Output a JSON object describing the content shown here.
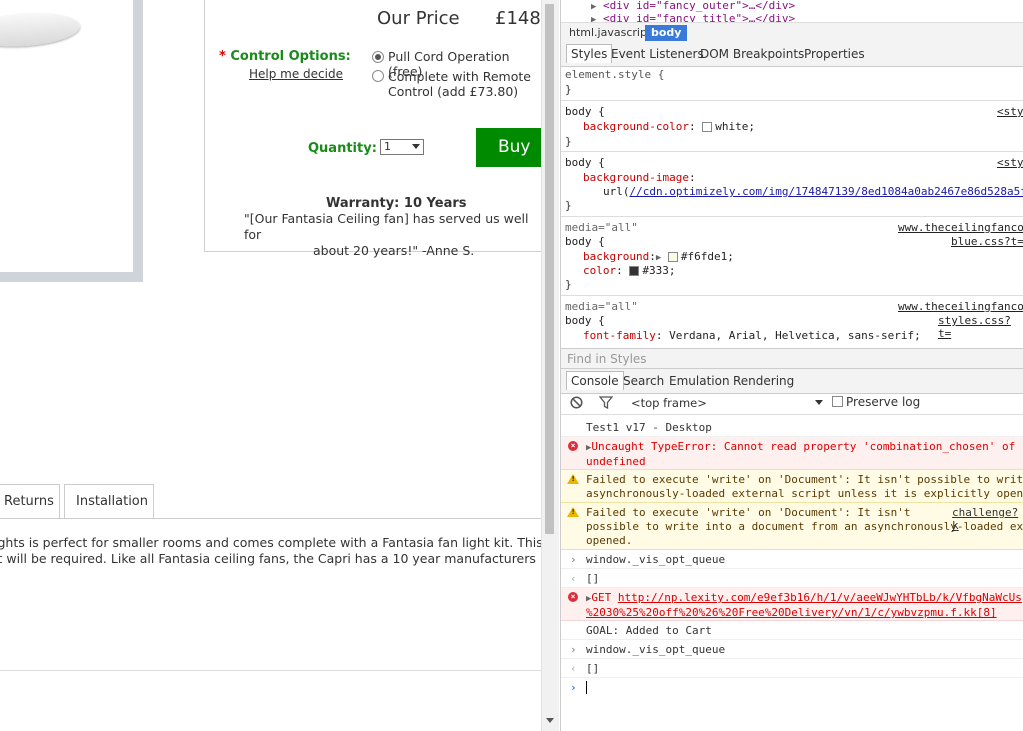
{
  "product": {
    "our_price_label": "Our Price",
    "price": "£148",
    "control_required_star": "*",
    "control_label": "Control Options:",
    "help_link": "Help me decide",
    "options": [
      {
        "label": "Pull Cord Operation (free)",
        "selected": true
      },
      {
        "label_line1": "Complete with Remote",
        "label_line2": "Control (add £73.80)",
        "selected": false
      }
    ],
    "quantity_label": "Quantity:",
    "quantity_value": "1",
    "buy_label": "Buy",
    "warranty": "Warranty: 10 Years",
    "quote_line1": "\"[Our Fantasia Ceiling fan] has served us well for",
    "quote_line2": "about 20 years!\" -Anne S."
  },
  "tabs": [
    "Returns",
    "Installation"
  ],
  "description": {
    "line1": "ights is perfect for smaller rooms and comes complete with a Fantasia fan light kit. This ce",
    "line2": "it will be required. Like all Fantasia ceiling fans, the Capri has a 10 year manufacturers"
  },
  "devtools": {
    "elements": {
      "line1": "<div id=\"fancy_outer\">…</div>",
      "line2": "<div id=\"fancy_title\">…</div>"
    },
    "breadcrumbs": [
      "html.javascript",
      "body"
    ],
    "subtabs": [
      "Styles",
      "Event Listeners",
      "DOM Breakpoints",
      "Properties"
    ],
    "styles": {
      "element_style": "element.style {",
      "close": "}",
      "rule1": {
        "selector": "body {",
        "source": "<sty",
        "prop": "background-color",
        "value": "white;"
      },
      "rule2": {
        "selector": "body {",
        "source": "<sty",
        "prop": "background-image",
        "url_fn": "url(",
        "url": "//cdn.optimizely.com/img/174847139/8ed1084a0ab2467e86d528a5f"
      },
      "rule3": {
        "media": "media=\"all\"",
        "selector": "body {",
        "source1": "www.theceilingfanco",
        "source2": "blue.css?t=",
        "prop1": "background",
        "value1": "#f6fde1;",
        "prop2": "color",
        "value2": "#333;"
      },
      "rule4": {
        "media": "media=\"all\"",
        "selector": "body {",
        "source1": "www.theceilingfanco",
        "source2": "styles.css?t=",
        "prop": "font-family",
        "value": "Verdana, Arial, Helvetica, sans-serif;"
      }
    },
    "find_placeholder": "Find in Styles",
    "drawer_tabs": [
      "Console",
      "Search",
      "Emulation",
      "Rendering"
    ],
    "frame": "<top frame>",
    "preserve_log": "Preserve log",
    "console": {
      "msg1": "Test1 v17 - Desktop",
      "err1_l1": "Uncaught TypeError: Cannot read property 'combination_chosen' of",
      "err1_l2": "undefined",
      "warn1_l1": "Failed to execute 'write' on 'Document': It isn't possible to write",
      "warn1_l2": "asynchronously-loaded external script unless it is explicitly opene",
      "warn2_l1": "Failed to execute 'write' on 'Document': It isn't",
      "warn2_src": "challenge?k",
      "warn2_l2": "possible to write into a document from an asynchronously-loaded ext",
      "warn2_l3": "opened.",
      "in1": "window._vis_opt_queue",
      "out1": "[]",
      "err2_method": "GET",
      "err2_url1": "http://np.lexity.com/e9ef3b16/h/1/v/aeeWJwYHTbLb/k/VfbgNaWcUs",
      "err2_url2": "%2030%25%20off%20%26%20Free%20Delivery/vn/1/c/ywbvzpmu.f.kk[8]",
      "goal": "GOAL: Added to Cart",
      "in2": "window._vis_opt_queue",
      "out2": "[]"
    },
    "colors": {
      "swatch_bg": "#f6fde1",
      "swatch_color": "#333333",
      "swatch_white": "#ffffff"
    }
  }
}
